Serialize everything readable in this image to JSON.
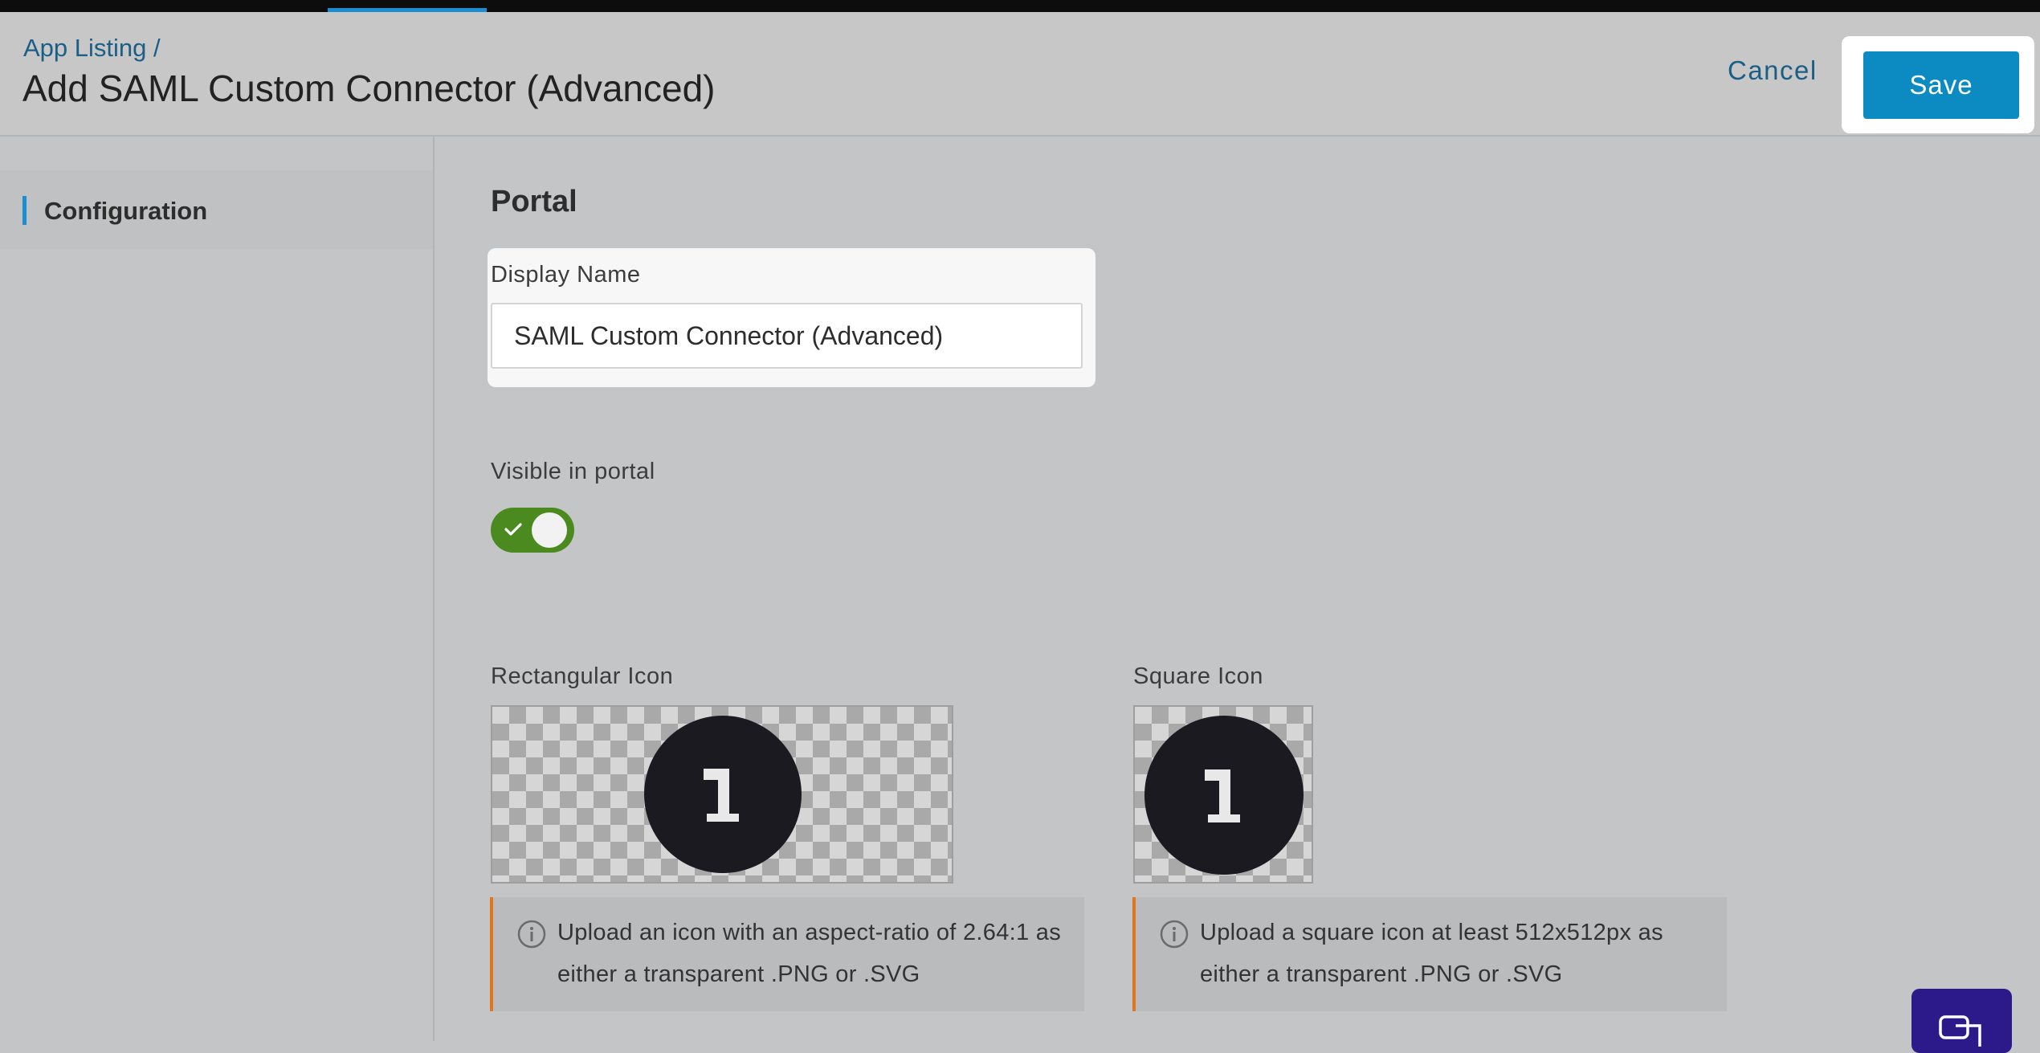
{
  "header": {
    "breadcrumb": "App Listing /",
    "title": "Add SAML Custom Connector (Advanced)",
    "cancel_label": "Cancel",
    "save_label": "Save"
  },
  "sidebar": {
    "items": [
      {
        "label": "Configuration",
        "active": true
      }
    ]
  },
  "main": {
    "section_title": "Portal",
    "display_name": {
      "label": "Display Name",
      "value": "SAML Custom Connector (Advanced)"
    },
    "visible_in_portal": {
      "label": "Visible in portal",
      "checked": true
    },
    "rect_icon": {
      "label": "Rectangular Icon",
      "logo_text": "1",
      "hint_line1": "Upload an icon with an aspect-ratio of 2.64:1 as",
      "hint_line2": "either a transparent .PNG or .SVG"
    },
    "square_icon": {
      "label": "Square Icon",
      "logo_text": "1",
      "hint_line1": "Upload a square icon at least 512x512px as",
      "hint_line2": "either a transparent .PNG or .SVG"
    }
  },
  "icons": [
    "check-icon",
    "info-icon",
    "chat-icon"
  ],
  "colors": {
    "primary": "#0c8bc2",
    "link": "#1b5f86",
    "toggle_on": "#4a8a1f",
    "warning_border": "#e0751c",
    "chat": "#2c1a8a"
  }
}
